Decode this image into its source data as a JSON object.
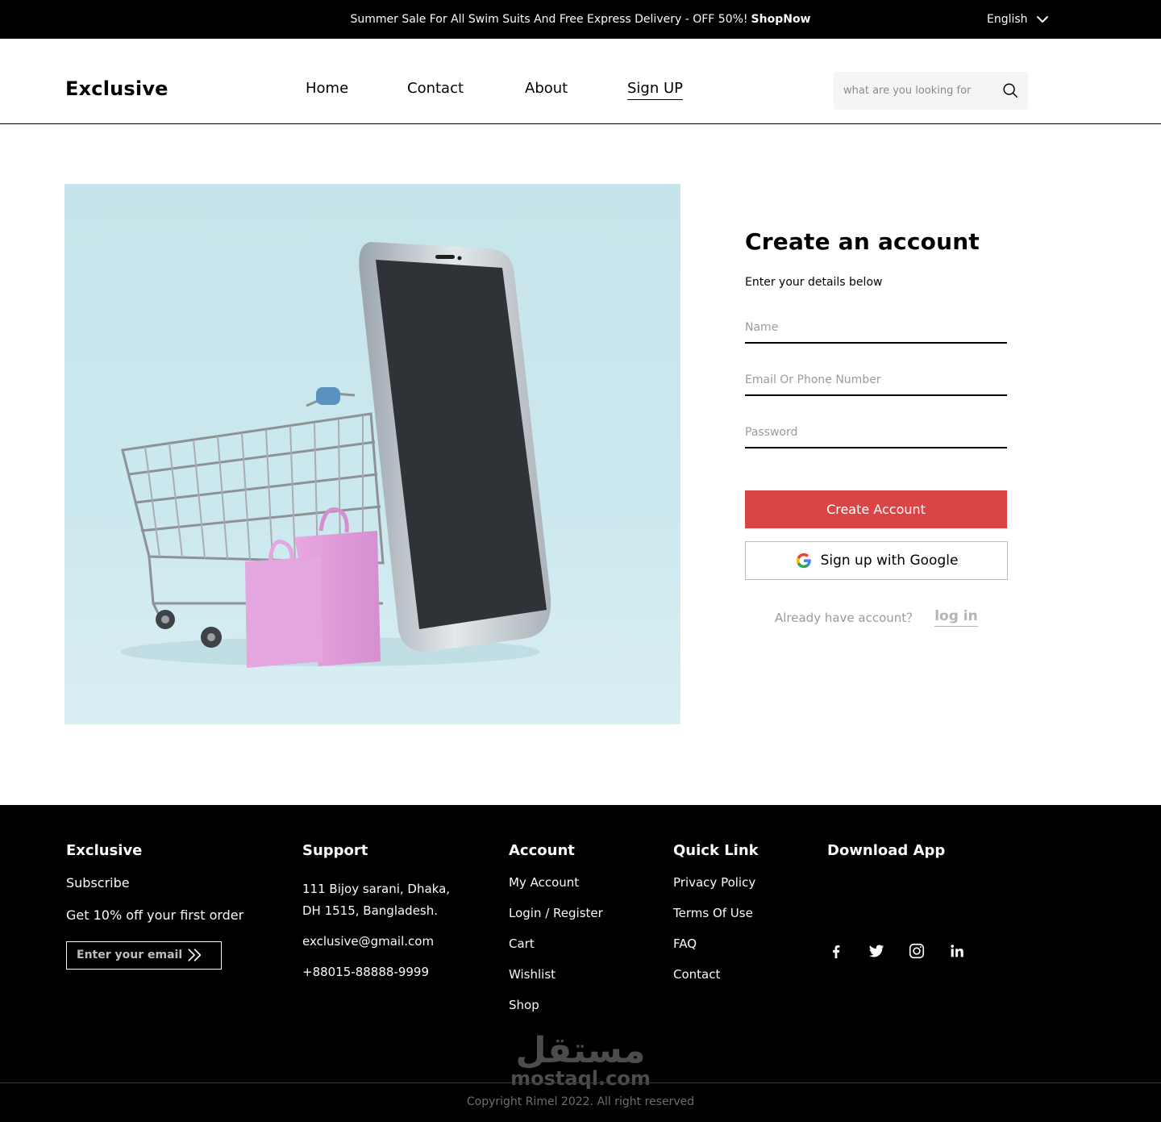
{
  "banner": {
    "message": "Summer Sale For All Swim Suits And Free Express Delivery - OFF 50%!",
    "cta": "ShopNow",
    "language": "English"
  },
  "header": {
    "logo": "Exclusive",
    "nav": [
      {
        "label": "Home"
      },
      {
        "label": "Contact"
      },
      {
        "label": "About"
      },
      {
        "label": "Sign UP",
        "active": true
      }
    ],
    "search_placeholder": "what are you looking for"
  },
  "form": {
    "title": "Create an account",
    "subtitle": "Enter your details below",
    "name_placeholder": "Name",
    "email_placeholder": "Email Or Phone Number",
    "password_placeholder": "Password",
    "create_button": "Create Account",
    "google_button": "Sign up with Google",
    "login_prompt": "Already have account？",
    "login_link": "log in"
  },
  "footer": {
    "brand": {
      "title": "Exclusive",
      "subscribe": "Subscribe",
      "offer": "Get 10% off your first order",
      "email_placeholder": "Enter your email"
    },
    "support": {
      "title": "Support",
      "address_line1": "111 Bijoy sarani, Dhaka,",
      "address_line2": "DH 1515, Bangladesh.",
      "email": "exclusive@gmail.com",
      "phone": "+88015-88888-9999"
    },
    "account": {
      "title": "Account",
      "links": [
        "My Account",
        "Login / Register",
        "Cart",
        "Wishlist",
        "Shop"
      ]
    },
    "quick_link": {
      "title": "Quick Link",
      "links": [
        "Privacy Policy",
        "Terms Of Use",
        "FAQ",
        "Contact"
      ]
    },
    "download": {
      "title": "Download App",
      "socials": [
        "facebook-icon",
        "twitter-icon",
        "instagram-icon",
        "linkedin-icon"
      ]
    },
    "watermark_arabic": "مستقل",
    "watermark_latin": "mostaql.com",
    "copyright": "Copyright Rimel 2022. All right reserved"
  },
  "colors": {
    "accent": "#db4444",
    "topbar": "#000000",
    "hero_bg": "#c6e5ea"
  }
}
